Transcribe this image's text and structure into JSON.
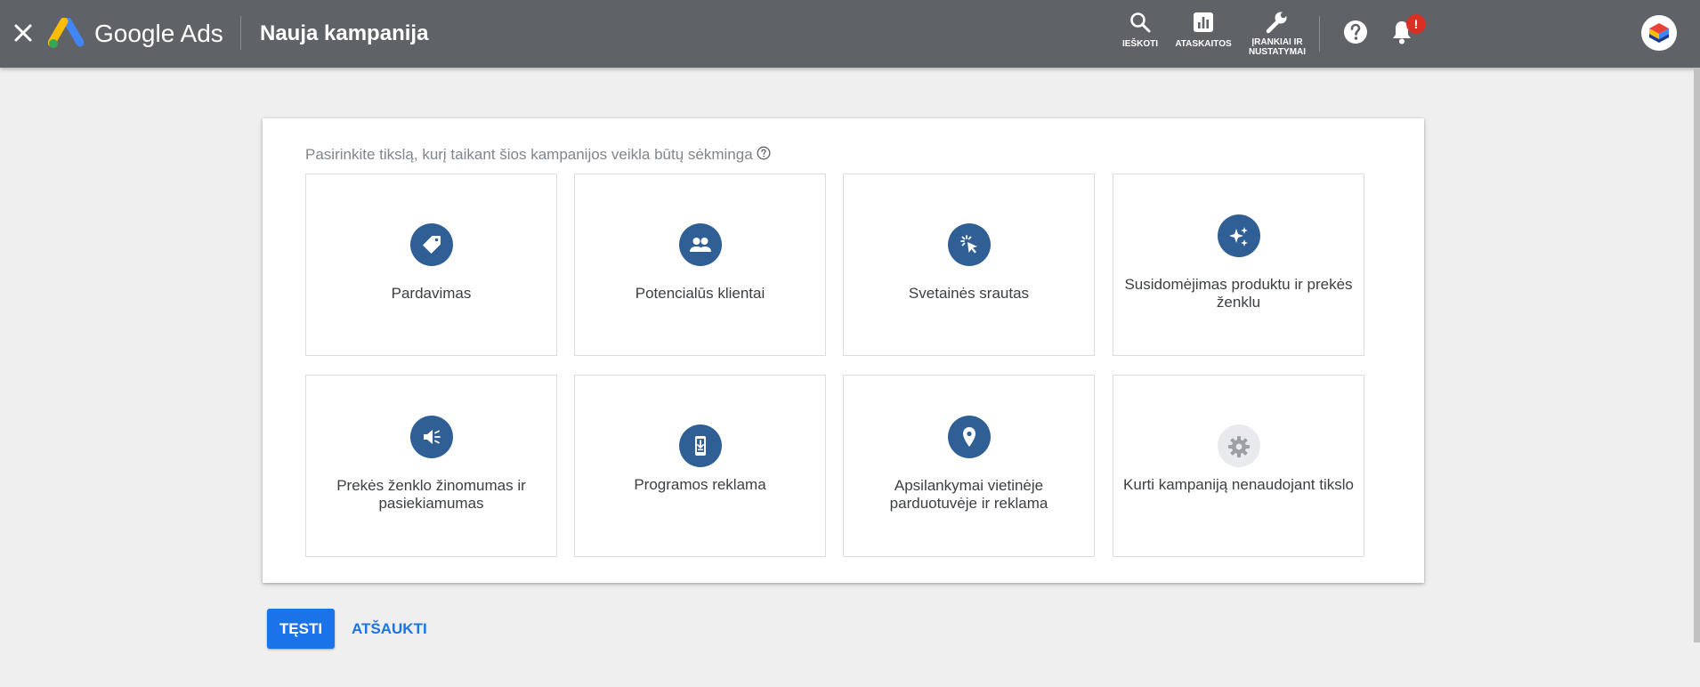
{
  "topbar": {
    "brand": "Google Ads",
    "title": "Nauja kampanija",
    "close_icon": "close-icon",
    "tools": [
      {
        "label": "IEŠKOTI",
        "icon": "search-icon"
      },
      {
        "label": "ATASKAITOS",
        "icon": "reports-icon"
      },
      {
        "label_line1": "ĮRANKIAI IR",
        "label_line2": "NUSTATYMAI",
        "icon": "wrench-icon"
      }
    ],
    "help_icon": "help-icon",
    "notifications": {
      "icon": "bell-icon",
      "badge": "!"
    }
  },
  "main": {
    "prompt": "Pasirinkite tikslą, kurį taikant šios kampanijos veikla būtų sėkminga",
    "goals": [
      {
        "label": "Pardavimas",
        "icon": "tag-icon"
      },
      {
        "label": "Potencialūs klientai",
        "icon": "people-icon"
      },
      {
        "label": "Svetainės srautas",
        "icon": "cursor-click-icon"
      },
      {
        "label_line1": "Susidomėjimas produktu ir prekės",
        "label_line2": "ženklu",
        "icon": "sparkle-icon"
      },
      {
        "label_line1": "Prekės ženklo žinomumas ir",
        "label_line2": "pasiekiamumas",
        "icon": "megaphone-icon"
      },
      {
        "label": "Programos reklama",
        "icon": "phone-download-icon"
      },
      {
        "label_line1": "Apsilankymai vietinėje",
        "label_line2": "parduotuvėje ir reklama",
        "icon": "location-pin-icon"
      },
      {
        "label": "Kurti kampaniją nenaudojant tikslo",
        "icon": "gear-icon"
      }
    ]
  },
  "actions": {
    "continue_label": "TĘSTI",
    "cancel_label": "ATŠAUKTI"
  },
  "colors": {
    "topbar": "#5f6368",
    "accent": "#1a73e8",
    "goal_icon": "#2f5f94",
    "badge": "#d93025"
  }
}
